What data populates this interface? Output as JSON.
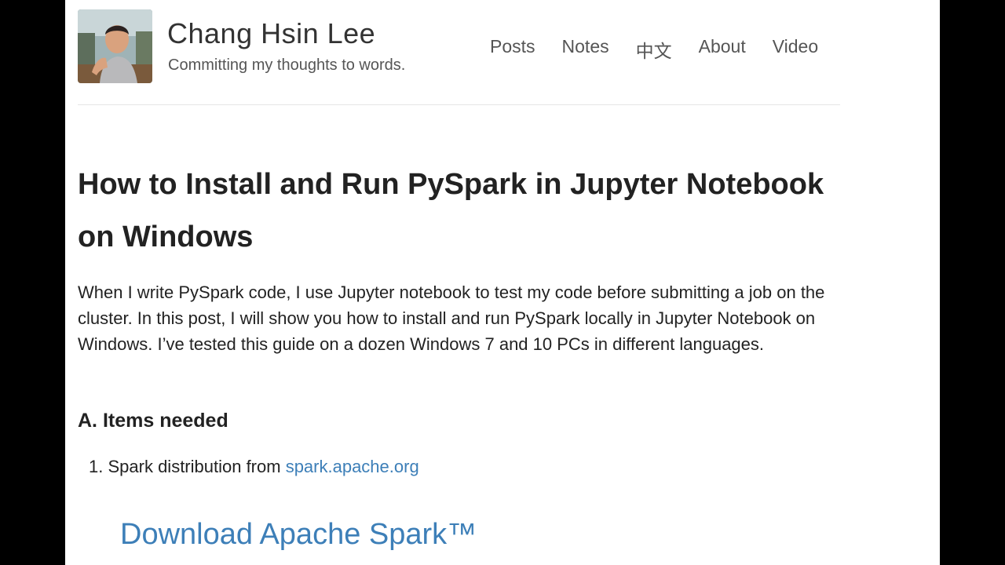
{
  "header": {
    "site_title": "Chang Hsin Lee",
    "tagline": "Committing my thoughts to words."
  },
  "nav": {
    "items": [
      {
        "label": "Posts"
      },
      {
        "label": "Notes"
      },
      {
        "label": "中文"
      },
      {
        "label": "About"
      },
      {
        "label": "Video"
      }
    ]
  },
  "post": {
    "title": "How to Install and Run PySpark in Jupyter Notebook on Windows",
    "intro": "When I write PySpark code, I use Jupyter notebook to test my code before submitting a job on the cluster. In this post, I will show you how to install and run PySpark locally in Jupyter Notebook on Windows. I’ve tested this guide on a dozen Windows 7 and 10 PCs in different languages.",
    "section_a": {
      "heading": "A. Items needed",
      "items": [
        {
          "number": "1.",
          "text": "Spark distribution from ",
          "link": "spark.apache.org"
        }
      ]
    },
    "download_heading": "Download Apache Spark™"
  },
  "colors": {
    "link": "#3d7fb8",
    "text": "#222222",
    "muted": "#555555",
    "background": "#ffffff",
    "letterbox": "#000000"
  }
}
